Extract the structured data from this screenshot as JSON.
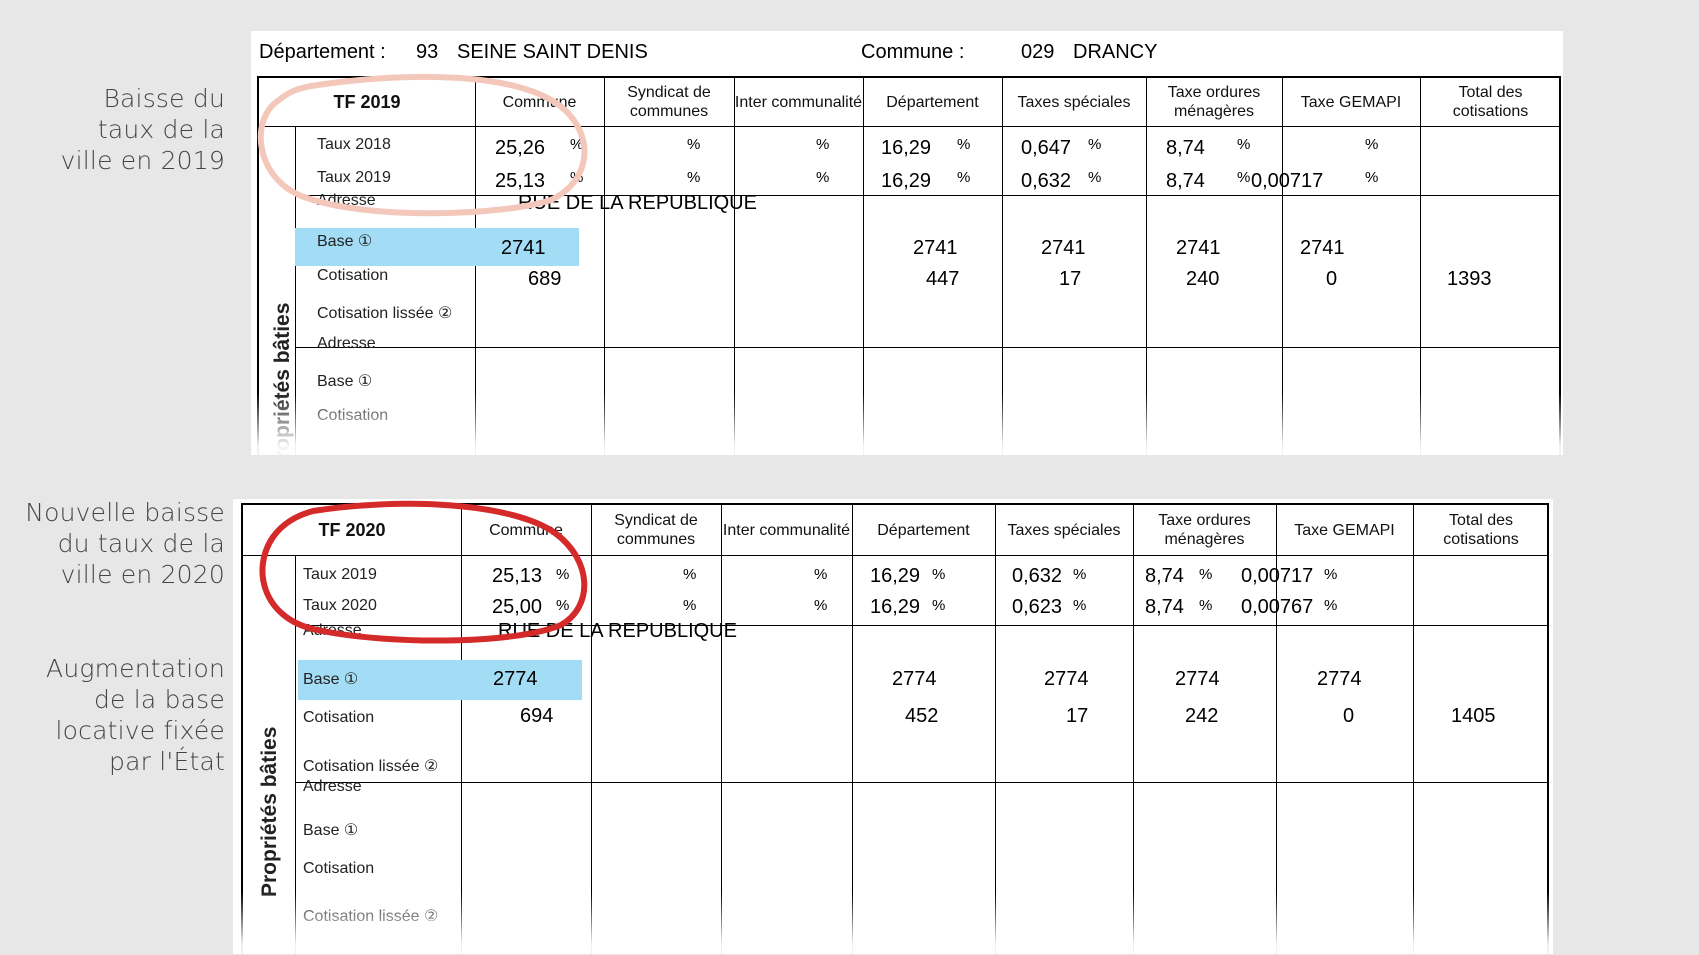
{
  "annotations": {
    "note1": [
      "Baisse du",
      "taux de la",
      "ville en 2019"
    ],
    "note2": [
      "Nouvelle baisse",
      "du taux de la",
      "ville en 2020"
    ],
    "note3": [
      "Augmentation",
      "de la base",
      "locative fixée",
      "par l'État"
    ]
  },
  "header": {
    "dept_label": "Département :",
    "dept_num": "93",
    "dept_name": "SEINE SAINT DENIS",
    "commune_label": "Commune :",
    "commune_num": "029",
    "commune_name": "DRANCY"
  },
  "columns": [
    "Commune",
    "Syndicat de communes",
    "Inter communalité",
    "Département",
    "Taxes spéciales",
    "Taxe ordures ménagères",
    "Taxe GEMAPI",
    "Total des cotisations"
  ],
  "percent_sign": "%",
  "side_label": "Propriétés bâties",
  "row_labels": {
    "adresse": "Adresse",
    "base": "Base ①",
    "cotisation": "Cotisation",
    "cotisation_lissee": "Cotisation lissée ②"
  },
  "address": "RUE DE LA REPUBLIQUE",
  "highlight_color": "#a3dcf5",
  "circle_colors": {
    "light": "#f3c7b9",
    "red": "#d42a2a"
  },
  "tf2019": {
    "title": "TF 2019",
    "rate_rows": [
      {
        "label": "Taux 2018",
        "commune": "25,26",
        "departement": "16,29",
        "taxes_speciales": "0,647",
        "ordures": "8,74",
        "gemapi": ""
      },
      {
        "label": "Taux 2019",
        "commune": "25,13",
        "departement": "16,29",
        "taxes_speciales": "0,632",
        "ordures": "8,74",
        "gemapi": "0,00717"
      }
    ],
    "base": {
      "commune": "2741",
      "departement": "2741",
      "taxes_speciales": "2741",
      "ordures": "2741",
      "gemapi": "2741"
    },
    "cotisation": {
      "commune": "689",
      "departement": "447",
      "taxes_speciales": "17",
      "ordures": "240",
      "gemapi": "0",
      "total": "1393"
    }
  },
  "tf2020": {
    "title": "TF 2020",
    "rate_rows": [
      {
        "label": "Taux 2019",
        "commune": "25,13",
        "departement": "16,29",
        "taxes_speciales": "0,632",
        "ordures": "8,74",
        "gemapi": "0,00717"
      },
      {
        "label": "Taux 2020",
        "commune": "25,00",
        "departement": "16,29",
        "taxes_speciales": "0,623",
        "ordures": "8,74",
        "gemapi": "0,00767"
      }
    ],
    "base": {
      "commune": "2774",
      "departement": "2774",
      "taxes_speciales": "2774",
      "ordures": "2774",
      "gemapi": "2774"
    },
    "cotisation": {
      "commune": "694",
      "departement": "452",
      "taxes_speciales": "17",
      "ordures": "242",
      "gemapi": "0",
      "total": "1405"
    }
  }
}
